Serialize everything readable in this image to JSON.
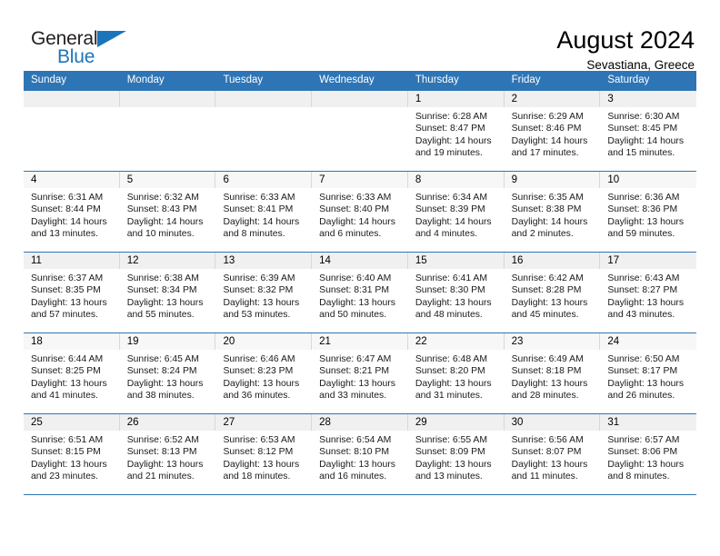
{
  "brand": {
    "name_top": "General",
    "name_bottom": "Blue",
    "flag_color": "#1b75bb"
  },
  "header": {
    "title": "August 2024",
    "location": "Sevastiana, Greece",
    "header_bg": "#2e75b6"
  },
  "weekday_headers": [
    "Sunday",
    "Monday",
    "Tuesday",
    "Wednesday",
    "Thursday",
    "Friday",
    "Saturday"
  ],
  "labels": {
    "sunrise": "Sunrise:",
    "sunset": "Sunset:",
    "daylight": "Daylight:"
  },
  "weeks": [
    {
      "shaded": true,
      "days": [
        {
          "empty": true
        },
        {
          "empty": true
        },
        {
          "empty": true
        },
        {
          "empty": true
        },
        {
          "date": "1",
          "sunrise": "Sunrise: 6:28 AM",
          "sunset": "Sunset: 8:47 PM",
          "daylight1": "Daylight: 14 hours",
          "daylight2": "and 19 minutes."
        },
        {
          "date": "2",
          "sunrise": "Sunrise: 6:29 AM",
          "sunset": "Sunset: 8:46 PM",
          "daylight1": "Daylight: 14 hours",
          "daylight2": "and 17 minutes."
        },
        {
          "date": "3",
          "sunrise": "Sunrise: 6:30 AM",
          "sunset": "Sunset: 8:45 PM",
          "daylight1": "Daylight: 14 hours",
          "daylight2": "and 15 minutes."
        }
      ]
    },
    {
      "shaded": false,
      "days": [
        {
          "date": "4",
          "sunrise": "Sunrise: 6:31 AM",
          "sunset": "Sunset: 8:44 PM",
          "daylight1": "Daylight: 14 hours",
          "daylight2": "and 13 minutes."
        },
        {
          "date": "5",
          "sunrise": "Sunrise: 6:32 AM",
          "sunset": "Sunset: 8:43 PM",
          "daylight1": "Daylight: 14 hours",
          "daylight2": "and 10 minutes."
        },
        {
          "date": "6",
          "sunrise": "Sunrise: 6:33 AM",
          "sunset": "Sunset: 8:41 PM",
          "daylight1": "Daylight: 14 hours",
          "daylight2": "and 8 minutes."
        },
        {
          "date": "7",
          "sunrise": "Sunrise: 6:33 AM",
          "sunset": "Sunset: 8:40 PM",
          "daylight1": "Daylight: 14 hours",
          "daylight2": "and 6 minutes."
        },
        {
          "date": "8",
          "sunrise": "Sunrise: 6:34 AM",
          "sunset": "Sunset: 8:39 PM",
          "daylight1": "Daylight: 14 hours",
          "daylight2": "and 4 minutes."
        },
        {
          "date": "9",
          "sunrise": "Sunrise: 6:35 AM",
          "sunset": "Sunset: 8:38 PM",
          "daylight1": "Daylight: 14 hours",
          "daylight2": "and 2 minutes."
        },
        {
          "date": "10",
          "sunrise": "Sunrise: 6:36 AM",
          "sunset": "Sunset: 8:36 PM",
          "daylight1": "Daylight: 13 hours",
          "daylight2": "and 59 minutes."
        }
      ]
    },
    {
      "shaded": true,
      "days": [
        {
          "date": "11",
          "sunrise": "Sunrise: 6:37 AM",
          "sunset": "Sunset: 8:35 PM",
          "daylight1": "Daylight: 13 hours",
          "daylight2": "and 57 minutes."
        },
        {
          "date": "12",
          "sunrise": "Sunrise: 6:38 AM",
          "sunset": "Sunset: 8:34 PM",
          "daylight1": "Daylight: 13 hours",
          "daylight2": "and 55 minutes."
        },
        {
          "date": "13",
          "sunrise": "Sunrise: 6:39 AM",
          "sunset": "Sunset: 8:32 PM",
          "daylight1": "Daylight: 13 hours",
          "daylight2": "and 53 minutes."
        },
        {
          "date": "14",
          "sunrise": "Sunrise: 6:40 AM",
          "sunset": "Sunset: 8:31 PM",
          "daylight1": "Daylight: 13 hours",
          "daylight2": "and 50 minutes."
        },
        {
          "date": "15",
          "sunrise": "Sunrise: 6:41 AM",
          "sunset": "Sunset: 8:30 PM",
          "daylight1": "Daylight: 13 hours",
          "daylight2": "and 48 minutes."
        },
        {
          "date": "16",
          "sunrise": "Sunrise: 6:42 AM",
          "sunset": "Sunset: 8:28 PM",
          "daylight1": "Daylight: 13 hours",
          "daylight2": "and 45 minutes."
        },
        {
          "date": "17",
          "sunrise": "Sunrise: 6:43 AM",
          "sunset": "Sunset: 8:27 PM",
          "daylight1": "Daylight: 13 hours",
          "daylight2": "and 43 minutes."
        }
      ]
    },
    {
      "shaded": false,
      "days": [
        {
          "date": "18",
          "sunrise": "Sunrise: 6:44 AM",
          "sunset": "Sunset: 8:25 PM",
          "daylight1": "Daylight: 13 hours",
          "daylight2": "and 41 minutes."
        },
        {
          "date": "19",
          "sunrise": "Sunrise: 6:45 AM",
          "sunset": "Sunset: 8:24 PM",
          "daylight1": "Daylight: 13 hours",
          "daylight2": "and 38 minutes."
        },
        {
          "date": "20",
          "sunrise": "Sunrise: 6:46 AM",
          "sunset": "Sunset: 8:23 PM",
          "daylight1": "Daylight: 13 hours",
          "daylight2": "and 36 minutes."
        },
        {
          "date": "21",
          "sunrise": "Sunrise: 6:47 AM",
          "sunset": "Sunset: 8:21 PM",
          "daylight1": "Daylight: 13 hours",
          "daylight2": "and 33 minutes."
        },
        {
          "date": "22",
          "sunrise": "Sunrise: 6:48 AM",
          "sunset": "Sunset: 8:20 PM",
          "daylight1": "Daylight: 13 hours",
          "daylight2": "and 31 minutes."
        },
        {
          "date": "23",
          "sunrise": "Sunrise: 6:49 AM",
          "sunset": "Sunset: 8:18 PM",
          "daylight1": "Daylight: 13 hours",
          "daylight2": "and 28 minutes."
        },
        {
          "date": "24",
          "sunrise": "Sunrise: 6:50 AM",
          "sunset": "Sunset: 8:17 PM",
          "daylight1": "Daylight: 13 hours",
          "daylight2": "and 26 minutes."
        }
      ]
    },
    {
      "shaded": true,
      "days": [
        {
          "date": "25",
          "sunrise": "Sunrise: 6:51 AM",
          "sunset": "Sunset: 8:15 PM",
          "daylight1": "Daylight: 13 hours",
          "daylight2": "and 23 minutes."
        },
        {
          "date": "26",
          "sunrise": "Sunrise: 6:52 AM",
          "sunset": "Sunset: 8:13 PM",
          "daylight1": "Daylight: 13 hours",
          "daylight2": "and 21 minutes."
        },
        {
          "date": "27",
          "sunrise": "Sunrise: 6:53 AM",
          "sunset": "Sunset: 8:12 PM",
          "daylight1": "Daylight: 13 hours",
          "daylight2": "and 18 minutes."
        },
        {
          "date": "28",
          "sunrise": "Sunrise: 6:54 AM",
          "sunset": "Sunset: 8:10 PM",
          "daylight1": "Daylight: 13 hours",
          "daylight2": "and 16 minutes."
        },
        {
          "date": "29",
          "sunrise": "Sunrise: 6:55 AM",
          "sunset": "Sunset: 8:09 PM",
          "daylight1": "Daylight: 13 hours",
          "daylight2": "and 13 minutes."
        },
        {
          "date": "30",
          "sunrise": "Sunrise: 6:56 AM",
          "sunset": "Sunset: 8:07 PM",
          "daylight1": "Daylight: 13 hours",
          "daylight2": "and 11 minutes."
        },
        {
          "date": "31",
          "sunrise": "Sunrise: 6:57 AM",
          "sunset": "Sunset: 8:06 PM",
          "daylight1": "Daylight: 13 hours",
          "daylight2": "and 8 minutes."
        }
      ]
    }
  ]
}
